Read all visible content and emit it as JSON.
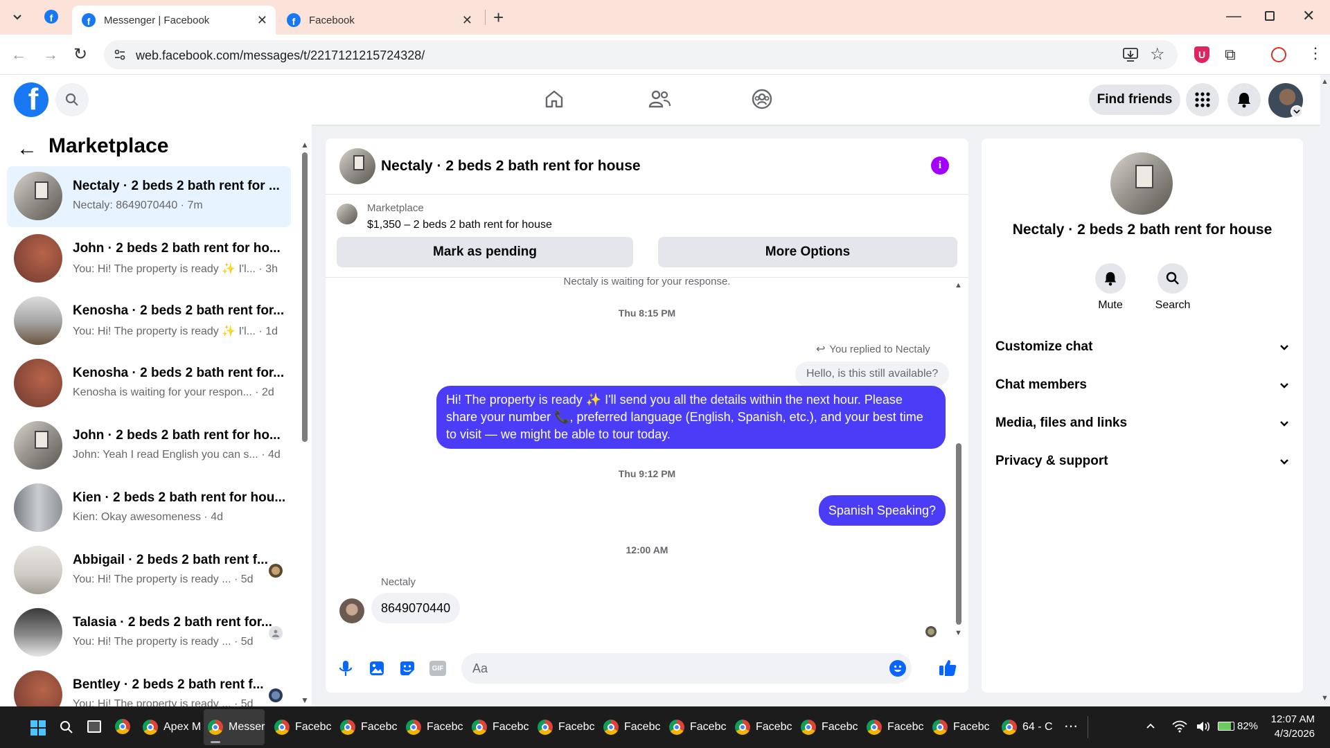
{
  "browser": {
    "tabs": [
      {
        "title": "Messenger | Facebook",
        "active": true
      },
      {
        "title": "Facebook",
        "active": false
      }
    ],
    "url": "web.facebook.com/messages/t/2217121215724328/"
  },
  "header": {
    "find_friends": "Find friends"
  },
  "sidebar": {
    "title": "Marketplace",
    "conversations": [
      {
        "title": "Nectaly · 2 beds 2 bath rent for ...",
        "preview": "Nectaly: 8649070440 · 7m",
        "selected": true
      },
      {
        "title": "John · 2 beds 2 bath rent for ho...",
        "preview": "You: Hi! The property is ready ✨ I'l... · 3h"
      },
      {
        "title": "Kenosha · 2 beds 2 bath rent for...",
        "preview": "You: Hi! The property is ready ✨ I'l... · 1d"
      },
      {
        "title": "Kenosha · 2 beds 2 bath rent for...",
        "preview": "Kenosha is waiting for your respon... · 2d"
      },
      {
        "title": "John · 2 beds 2 bath rent for ho...",
        "preview": "John: Yeah I read English you can s... · 4d"
      },
      {
        "title": "Kien · 2 beds 2 bath rent for hou...",
        "preview": "Kien: Okay awesomeness · 4d"
      },
      {
        "title": "Abbigail · 2 beds 2 bath rent f...",
        "preview": "You: Hi! The property is ready ...   · 5d"
      },
      {
        "title": "Talasia · 2 beds 2 bath rent for...",
        "preview": "You: Hi! The property is ready ...   · 5d"
      },
      {
        "title": "Bentley · 2 beds 2 bath rent f...",
        "preview": "You: Hi! The property is ready ...   · 5d"
      }
    ]
  },
  "chat": {
    "title": "Nectaly · 2 beds 2 bath rent for house",
    "listing_source": "Marketplace",
    "listing_desc": "$1,350 – 2 beds 2 bath rent for house",
    "mark_pending": "Mark as pending",
    "more_options": "More Options",
    "waiting_notice": "Nectaly is waiting for your response.",
    "time1": "Thu 8:15 PM",
    "replied_to": "You replied to Nectaly",
    "quoted": "Hello, is this still available?",
    "msg1": "Hi! The property is ready ✨ I'll send you all the details within the next hour. Please share your number 📞, preferred language (English, Spanish, etc.), and your best time to visit — we might be able to tour today.",
    "time2": "Thu 9:12 PM",
    "msg2": "Spanish Speaking?",
    "time3": "12:00 AM",
    "sender": "Nectaly",
    "msg3": "8649070440",
    "composer_placeholder": "Aa"
  },
  "details": {
    "title": "Nectaly · 2 beds 2 bath rent for house",
    "mute": "Mute",
    "search": "Search",
    "sections": [
      "Customize chat",
      "Chat members",
      "Media, files and links",
      "Privacy & support"
    ]
  },
  "taskbar": {
    "items": [
      "Apex M",
      "Messer",
      "Facebc",
      "Facebc",
      "Facebc",
      "Facebc",
      "Facebc",
      "Facebc",
      "Facebc",
      "Facebc",
      "Facebc",
      "Facebc",
      "Facebc",
      "64 - C"
    ],
    "battery": "82%",
    "time": "12:07 AM",
    "date": "4/3/2026"
  },
  "colors": {
    "fb_blue": "#1877f2",
    "outgoing_bubble": "#4a3cf7",
    "info_purple": "#a200ff"
  }
}
